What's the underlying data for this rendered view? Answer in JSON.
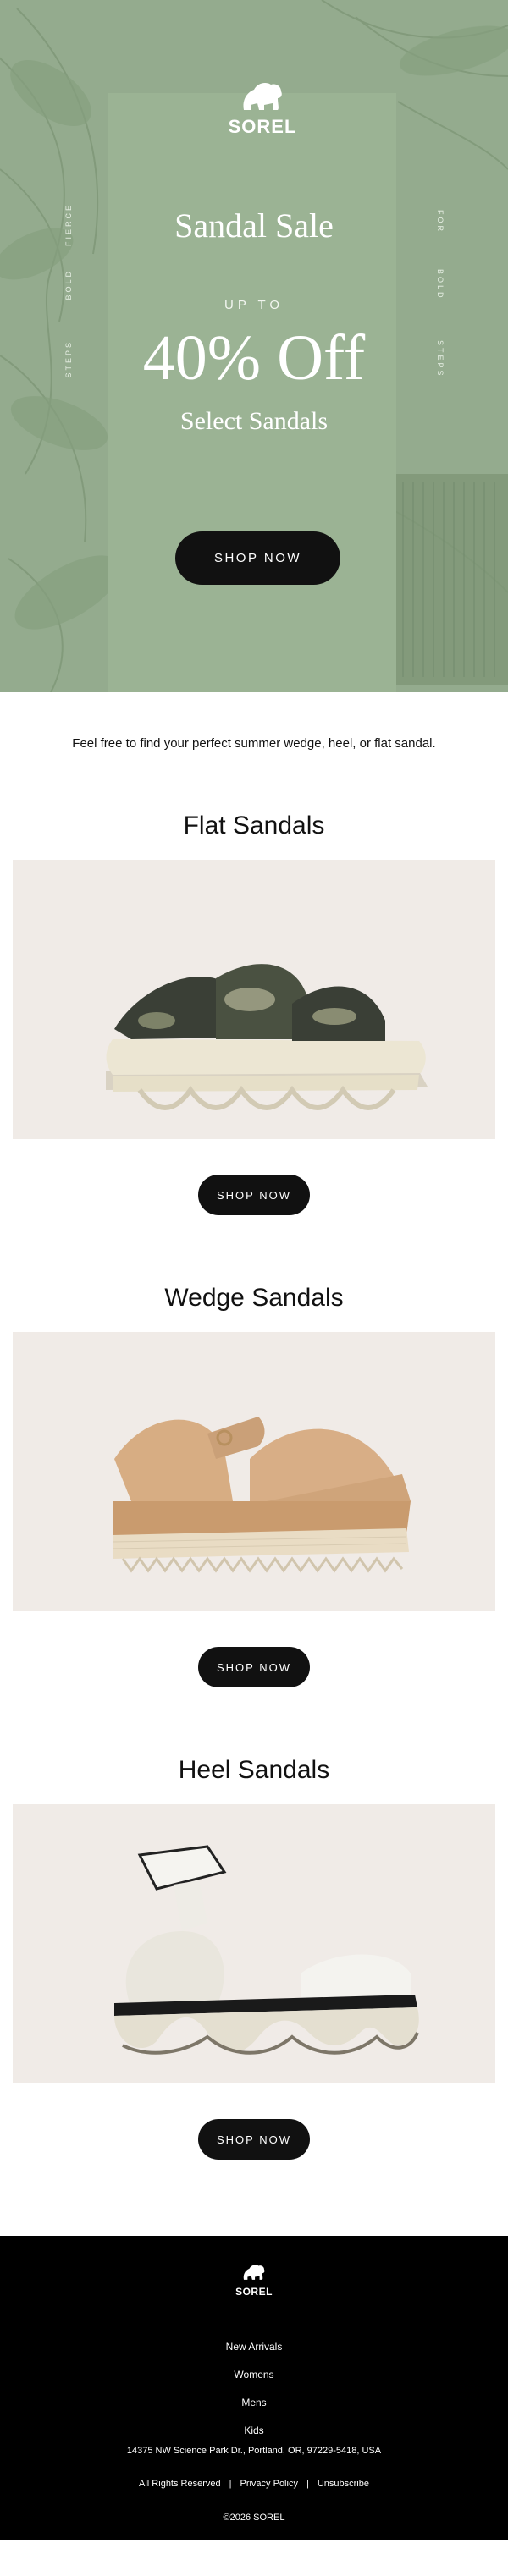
{
  "hero": {
    "brand": "SOREL",
    "title": "Sandal Sale",
    "upto": "UP TO",
    "discount": "40% Off",
    "subtitle": "Select Sandals",
    "vertical_left_1": "FIERCE",
    "vertical_left_2": "BOLD",
    "vertical_left_3": "STEPS",
    "vertical_right_1": "FOR",
    "vertical_right_2": "BOLD",
    "vertical_right_3": "STEPS",
    "cta": "SHOP NOW"
  },
  "intro": "Feel free to find your perfect summer wedge, heel, or flat sandal.",
  "products": [
    {
      "title": "Flat Sandals",
      "cta": "SHOP NOW"
    },
    {
      "title": "Wedge Sandals",
      "cta": "SHOP NOW"
    },
    {
      "title": "Heel Sandals",
      "cta": "SHOP NOW"
    }
  ],
  "footer": {
    "brand": "SOREL",
    "links": [
      "New Arrivals",
      "Womens",
      "Mens",
      "Kids"
    ],
    "address": "14375 NW Science Park Dr., Portland, OR, 97229-5418, USA",
    "rights": "All Rights Reserved",
    "privacy": "Privacy Policy",
    "unsubscribe": "Unsubscribe",
    "copyright": "©2026 SOREL"
  },
  "colors": {
    "hero_bg": "#94ab8e",
    "card_bg": "#f0ebe7",
    "button": "#111111",
    "footer_bg": "#000000"
  }
}
